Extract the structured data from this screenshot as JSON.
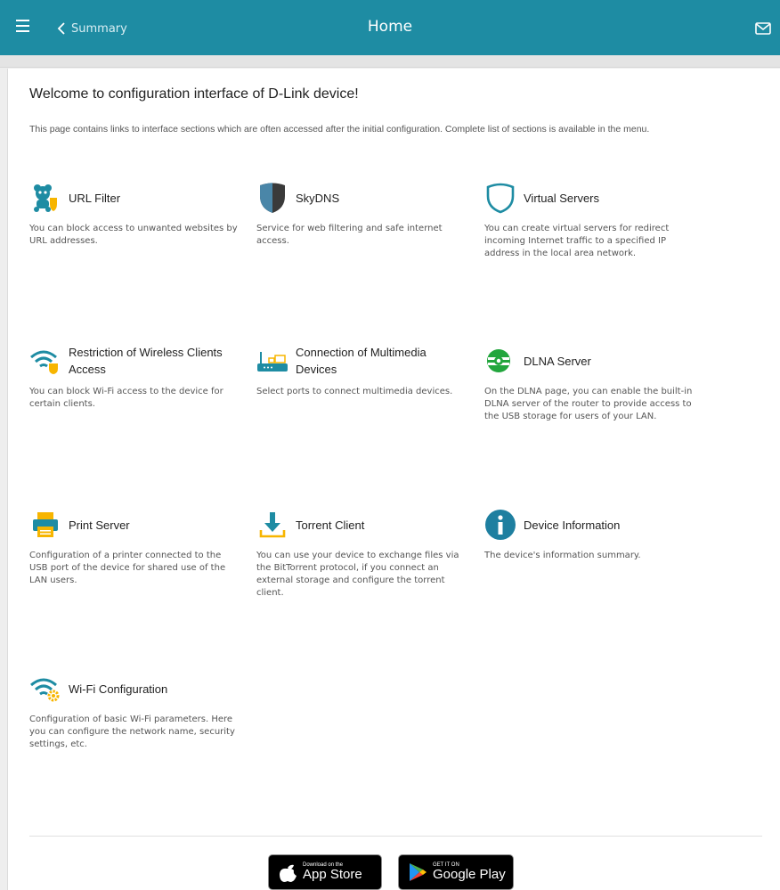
{
  "header": {
    "back_label": "Summary",
    "title": "Home",
    "bg_color": "#1e8ca3"
  },
  "main": {
    "welcome": "Welcome to configuration interface of D-Link device!",
    "intro": "This page contains links to interface sections which are often accessed after the initial configuration. Complete list of sections is available in the menu."
  },
  "cards": [
    {
      "title": "URL Filter",
      "desc": "You can block access to unwanted websites by URL addresses.",
      "icon": "url-filter-icon"
    },
    {
      "title": "SkyDNS",
      "desc": "Service for web filtering and safe internet access.",
      "icon": "skydns-shield-icon"
    },
    {
      "title": "Virtual Servers",
      "desc": "You can create virtual servers for redirect incoming Internet traffic to a specified IP address in the local area network.",
      "icon": "virtual-servers-shield-icon"
    },
    {
      "title": "Restriction of Wireless Clients Access",
      "desc": "You can block Wi-Fi access to the device for certain clients.",
      "icon": "wifi-shield-icon"
    },
    {
      "title": "Connection of Multimedia Devices",
      "desc": "Select ports to connect multimedia devices.",
      "icon": "multimedia-router-icon"
    },
    {
      "title": "DLNA Server",
      "desc": "On the DLNA page, you can enable the built-in DLNA server of the router to provide access to the USB storage for users of your LAN.",
      "icon": "dlna-icon"
    },
    {
      "title": "Print Server",
      "desc": "Configuration of a printer connected to the USB port of the device for shared use of the LAN users.",
      "icon": "printer-icon"
    },
    {
      "title": "Torrent Client",
      "desc": "You can use your device to exchange files via the BitTorrent protocol, if you connect an external storage and configure the torrent client.",
      "icon": "download-icon"
    },
    {
      "title": "Device Information",
      "desc": "The device's information summary.",
      "icon": "info-icon"
    },
    {
      "title": "Wi-Fi Configuration",
      "desc": "Configuration of basic Wi-Fi parameters. Here you can configure the network name, security settings, etc.",
      "icon": "wifi-gear-icon"
    }
  ],
  "footer": {
    "appstore_small": "Download on the",
    "appstore_big": "App Store",
    "googleplay_small": "GET IT ON",
    "googleplay_big": "Google Play"
  }
}
